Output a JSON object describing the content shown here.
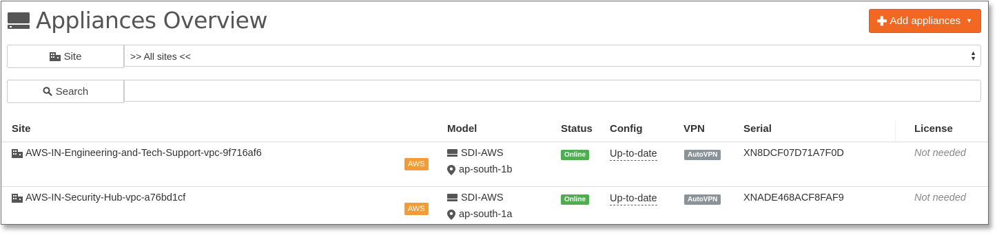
{
  "header": {
    "title": "Appliances Overview",
    "add_button": "Add appliances",
    "add_button_color": "#f26722"
  },
  "filters": {
    "site_label": "Site",
    "site_value": ">> All sites <<",
    "search_label": "Search",
    "search_value": ""
  },
  "table": {
    "columns": [
      "Site",
      "Model",
      "Status",
      "Config",
      "VPN",
      "Serial",
      "License"
    ],
    "rows": [
      {
        "site": "AWS-IN-Engineering-and-Tech-Support-vpc-9f716af6",
        "cloud_badge": "AWS",
        "model": "SDI-AWS",
        "region": "ap-south-1b",
        "status": "Online",
        "config": "Up-to-date",
        "vpn": "AutoVPN",
        "serial": "XN8DCF07D71A7F0D",
        "license": "Not needed"
      },
      {
        "site": "AWS-IN-Security-Hub-vpc-a76bd1cf",
        "cloud_badge": "AWS",
        "model": "SDI-AWS",
        "region": "ap-south-1a",
        "status": "Online",
        "config": "Up-to-date",
        "vpn": "AutoVPN",
        "serial": "XNADE468ACF8FAF9",
        "license": "Not needed"
      }
    ]
  },
  "icons": [
    "appliance-icon",
    "plus-icon",
    "caret-down-icon",
    "building-icon",
    "search-icon",
    "select-arrows-icon",
    "map-marker-icon"
  ]
}
